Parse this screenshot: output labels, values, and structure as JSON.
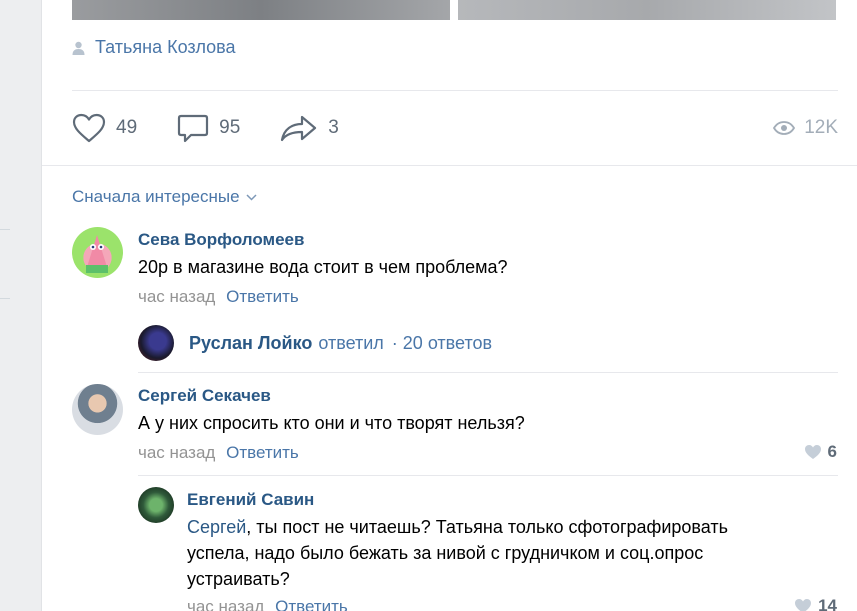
{
  "post": {
    "author": "Татьяна Козлова",
    "likes": "49",
    "comments": "95",
    "shares": "3",
    "views": "12K"
  },
  "comments_sort": "Сначала интересные",
  "comments": [
    {
      "name": "Сева Ворфоломеев",
      "text": "20р в магазине вода стоит в чем проблема?",
      "time": "час назад",
      "reply_label": "Ответить"
    },
    {
      "thread_name": "Руслан Лойко",
      "thread_verb": "ответил",
      "thread_count": "· 20 ответов"
    },
    {
      "name": "Сергей Секачев",
      "text": "А у них спросить кто они и что творят нельзя?",
      "time": "час назад",
      "reply_label": "Ответить",
      "likes": "6"
    },
    {
      "name": "Евгений Савин",
      "mention": "Сергей",
      "text_line1": ", ты пост не читаешь? Татьяна только сфотографировать",
      "text_line2": "успела, надо было бежать за нивой с грудничком и соц.опрос",
      "text_line3": "устраивать?",
      "time": "час назад",
      "reply_label": "Ответить",
      "likes": "14"
    }
  ],
  "colors": {
    "link": "#2a5885",
    "accent": "#4a76a8",
    "muted": "#939393",
    "icon": "#5f6b78"
  }
}
